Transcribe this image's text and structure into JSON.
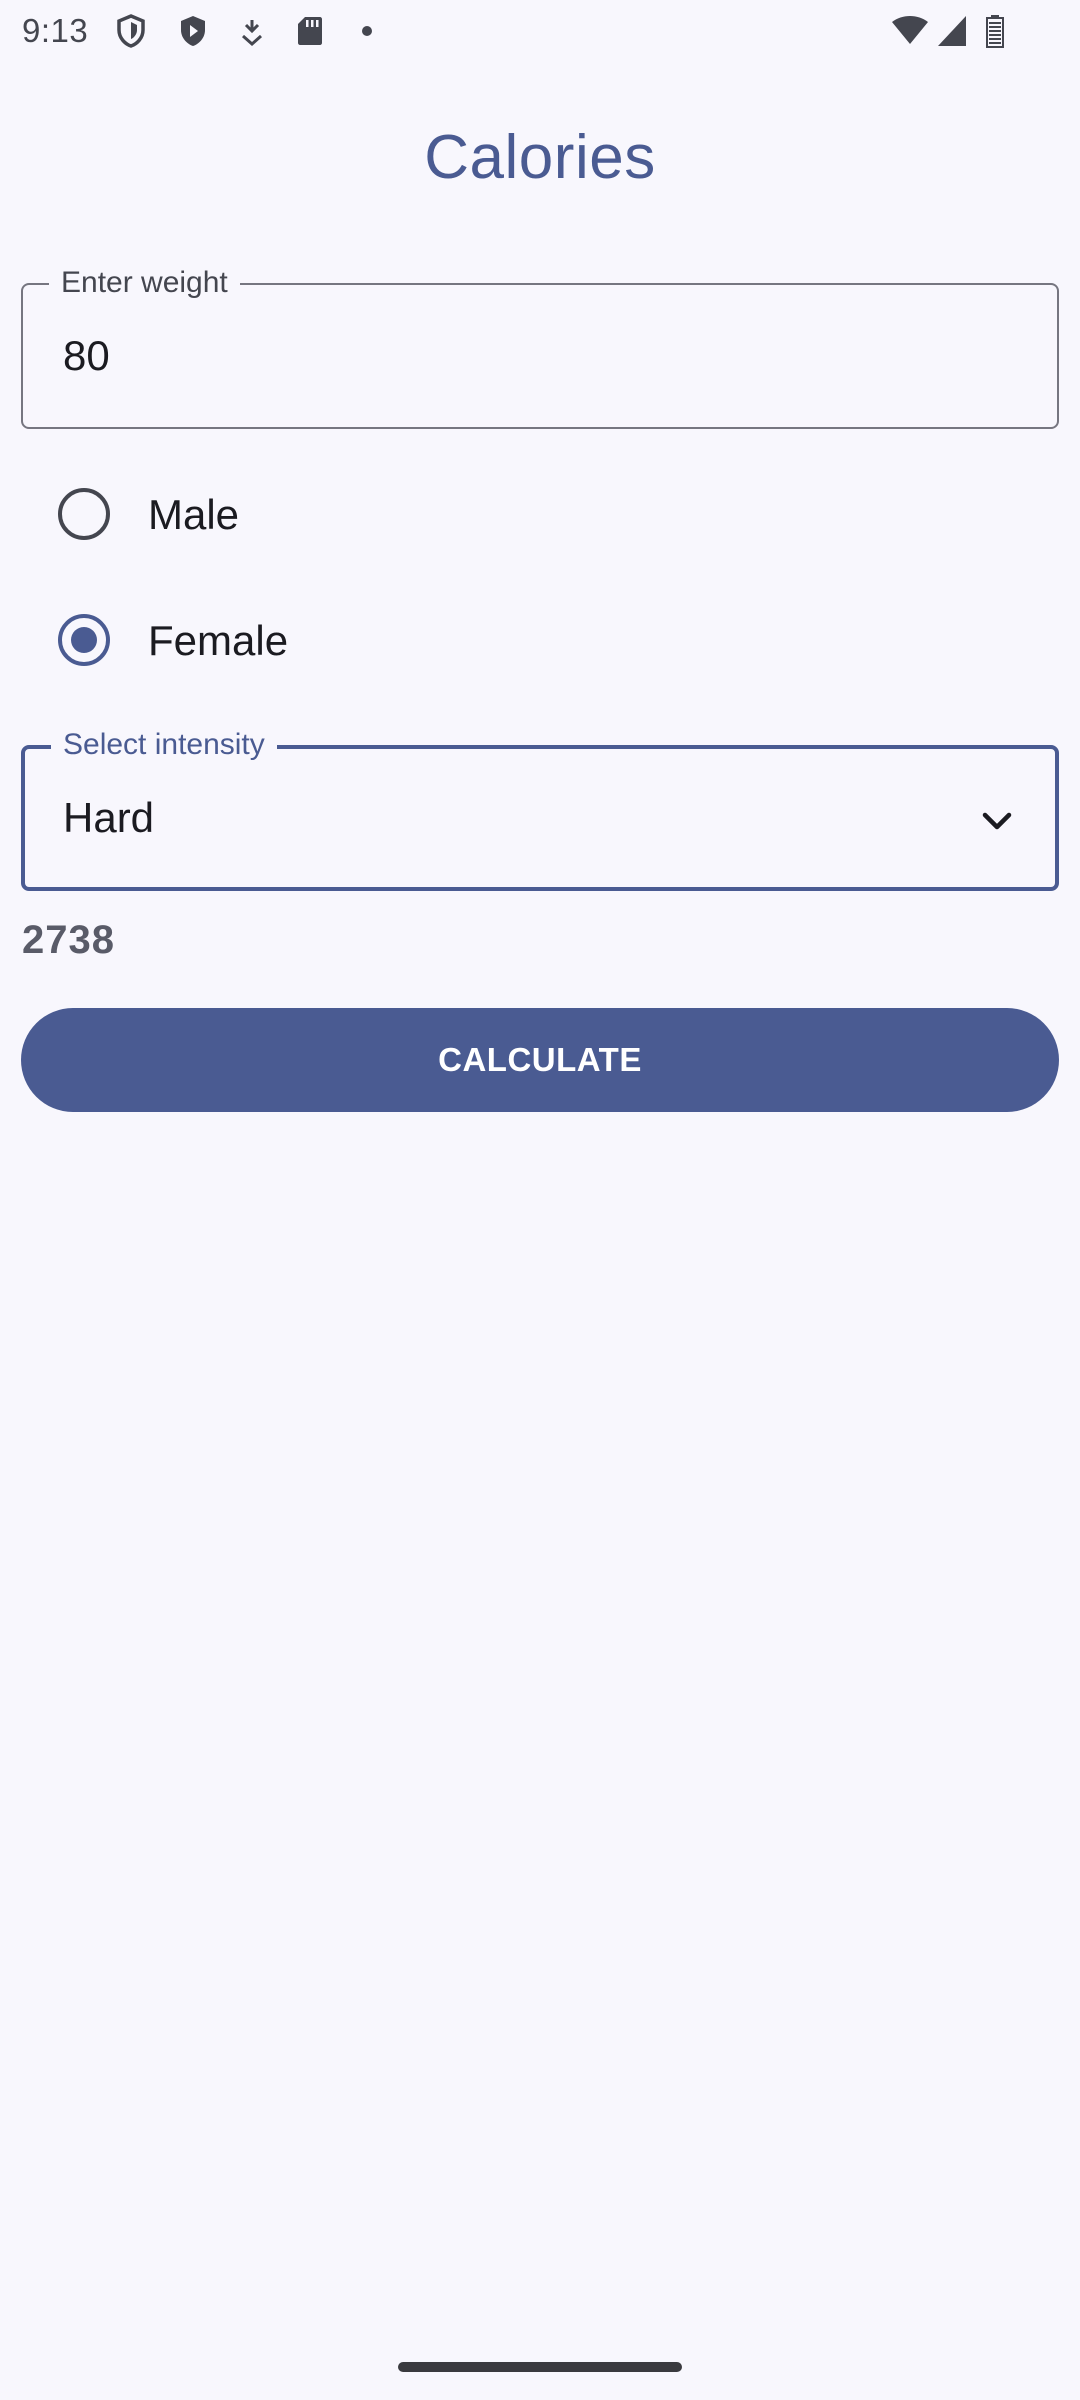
{
  "status_bar": {
    "time": "9:13",
    "icons_left": [
      "shield-outline-icon",
      "shield-play-icon",
      "download-icon",
      "sd-card-icon",
      "dot-icon"
    ],
    "icons_right": [
      "wifi-icon",
      "cell-signal-icon",
      "battery-icon"
    ]
  },
  "app": {
    "title": "Calories"
  },
  "weight_field": {
    "label": "Enter weight",
    "value": "80"
  },
  "gender": {
    "options": [
      {
        "label": "Male",
        "checked": false
      },
      {
        "label": "Female",
        "checked": true
      }
    ]
  },
  "intensity_field": {
    "label": "Select intensity",
    "value": "Hard"
  },
  "result": {
    "value": "2738"
  },
  "actions": {
    "calculate_label": "CALCULATE"
  },
  "colors": {
    "primary": "#4a5b92",
    "background": "#f8f7fd",
    "on_surface": "#1b1b21"
  }
}
